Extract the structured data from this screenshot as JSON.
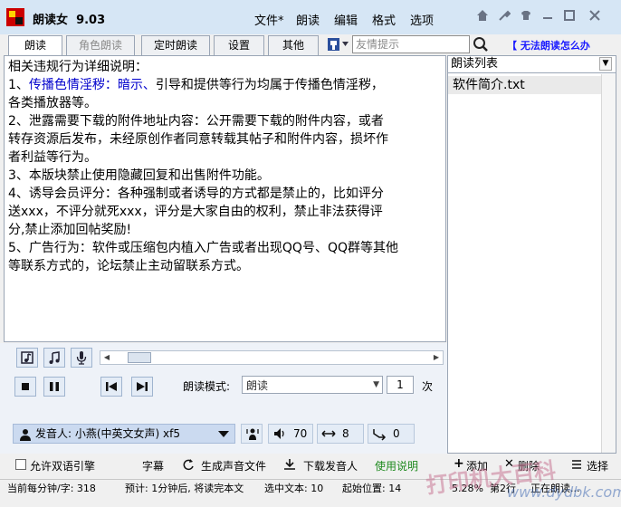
{
  "window": {
    "title": "朗读女",
    "version": "9.03",
    "accent": "#d6e6f5"
  },
  "menu": [
    "文件*",
    "朗读",
    "编辑",
    "格式",
    "选项"
  ],
  "tabs": [
    {
      "label": "朗读",
      "active": true
    },
    {
      "label": "角色朗读",
      "disabled": true
    },
    {
      "label": "定时朗读"
    },
    {
      "label": "设置"
    },
    {
      "label": "其他"
    }
  ],
  "search": {
    "placeholder": "友情提示"
  },
  "help_link": "【 无法朗读怎么办",
  "text_lines": [
    {
      "text": "相关违规行为详细说明："
    },
    {
      "prefix": "1、",
      "blue": "传播色情淫秽：暗示、",
      "text": "引导和提供等行为均属于传播色情淫秽，"
    },
    {
      "text": "各类播放器等。"
    },
    {
      "text": "2、泄露需要下载的附件地址内容：公开需要下载的附件内容，或者"
    },
    {
      "text": "转存资源后发布，未经原创作者同意转载其帖子和附件内容，损坏作"
    },
    {
      "text": "者利益等行为。"
    },
    {
      "text": "3、本版块禁止使用隐藏回复和出售附件功能。"
    },
    {
      "text": "4、诱导会员评分：各种强制或者诱导的方式都是禁止的，比如评分"
    },
    {
      "text": "送xxx，不评分就死xxx，评分是大家自由的权利，禁止非法获得评"
    },
    {
      "text": "分,禁止添加回帖奖励!"
    },
    {
      "text": "5、广告行为：软件或压缩包内植入广告或者出现QQ号、QQ群等其他"
    },
    {
      "text": "等联系方式的，论坛禁止主动留联系方式。"
    }
  ],
  "reading_list": {
    "header": "朗读列表",
    "items": [
      "软件简介.txt"
    ]
  },
  "controls": {
    "mode_label": "朗读模式:",
    "mode_value": "朗读",
    "repeat_count": "1",
    "repeat_unit": "次",
    "voice": "发音人: 小燕(中英文女声) xf5",
    "volume": "70",
    "speed": "8",
    "pitch": "0",
    "icons": [
      "text-mode-icon",
      "music-icon",
      "microphone-icon",
      "stop-icon",
      "pause-icon",
      "prev-icon",
      "next-icon"
    ]
  },
  "bottom": {
    "bilingual": "允许双语引擎",
    "subtitle": "字幕",
    "gen_audio": "生成声音文件",
    "download_voice": "下载发音人",
    "usage": "使用说明",
    "add": "添加",
    "delete": "删除",
    "select": "选择"
  },
  "status": {
    "per_minute": "当前每分钟/字: 318",
    "estimate": "预计: 1分钟后, 将读完本文",
    "selected": "选中文本: 10",
    "start_pos": "起始位置: 14",
    "percent": "5.28%",
    "row": "第2行",
    "state": "正在朗读..."
  },
  "watermark": {
    "text": "打印机大百科",
    "url": "www.dydbk.com"
  }
}
